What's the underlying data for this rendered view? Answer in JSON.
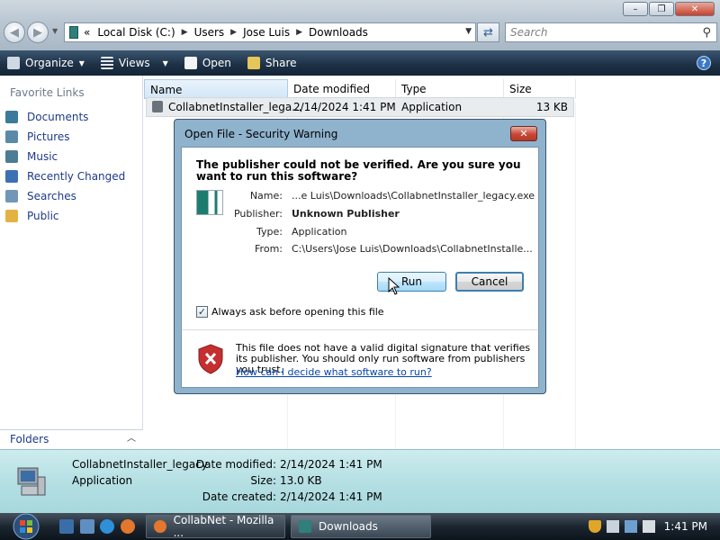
{
  "explorer": {
    "address": {
      "prefix": "«",
      "crumbs": [
        "Local Disk (C:)",
        "Users",
        "Jose Luis",
        "Downloads"
      ]
    },
    "search": {
      "placeholder": "Search"
    },
    "toolbar": {
      "organize": "Organize",
      "views": "Views",
      "open": "Open",
      "share": "Share"
    },
    "nav_pane": {
      "title": "Favorite Links",
      "items": [
        {
          "label": "Documents",
          "icon": "documents-icon",
          "color": "#3b7a9a"
        },
        {
          "label": "Pictures",
          "icon": "pictures-icon",
          "color": "#5a8aa6"
        },
        {
          "label": "Music",
          "icon": "music-icon",
          "color": "#4d7c95"
        },
        {
          "label": "Recently Changed",
          "icon": "recently-changed-icon",
          "color": "#3d6fb5"
        },
        {
          "label": "Searches",
          "icon": "searches-icon",
          "color": "#7296b6"
        },
        {
          "label": "Public",
          "icon": "public-folder-icon",
          "color": "#e3b341"
        }
      ],
      "folders_label": "Folders"
    },
    "columns": {
      "name": "Name",
      "date_modified": "Date modified",
      "type": "Type",
      "size": "Size"
    },
    "files": [
      {
        "name": "CollabnetInstaller_lega...",
        "date_modified": "2/14/2024 1:41 PM",
        "type": "Application",
        "size": "13 KB"
      }
    ],
    "details": {
      "name": "CollabnetInstaller_legacy",
      "type": "Application",
      "date_modified_label": "Date modified:",
      "date_modified": "2/14/2024 1:41 PM",
      "size_label": "Size:",
      "size": "13.0 KB",
      "date_created_label": "Date created:",
      "date_created": "2/14/2024 1:41 PM"
    }
  },
  "dialog": {
    "title": "Open File - Security Warning",
    "headline": "The publisher could not be verified.  Are you sure you want to run this software?",
    "fields": {
      "name_label": "Name:",
      "name": "...e Luis\\Downloads\\CollabnetInstaller_legacy.exe",
      "publisher_label": "Publisher:",
      "publisher": "Unknown Publisher",
      "type_label": "Type:",
      "type": "Application",
      "from_label": "From:",
      "from": "C:\\Users\\Jose Luis\\Downloads\\CollabnetInstalle..."
    },
    "run_label": "Run",
    "cancel_label": "Cancel",
    "checkbox_label": "Always ask before opening this file",
    "checkbox_checked": true,
    "warning_text": "This file does not have a valid digital signature that verifies its publisher.  You should only run software from publishers you trust.",
    "link": "How can I decide what software to run?"
  },
  "taskbar": {
    "buttons": [
      {
        "label": "CollabNet - Mozilla ...",
        "icon": "firefox-icon"
      },
      {
        "label": "Downloads",
        "icon": "folder-icon"
      }
    ],
    "clock": "1:41 PM"
  },
  "colors": {
    "toolbar": "#1e3247",
    "dialog_frame": "#8fb2cd",
    "details_pane": "#b5e0e4",
    "link": "#0645ad"
  }
}
